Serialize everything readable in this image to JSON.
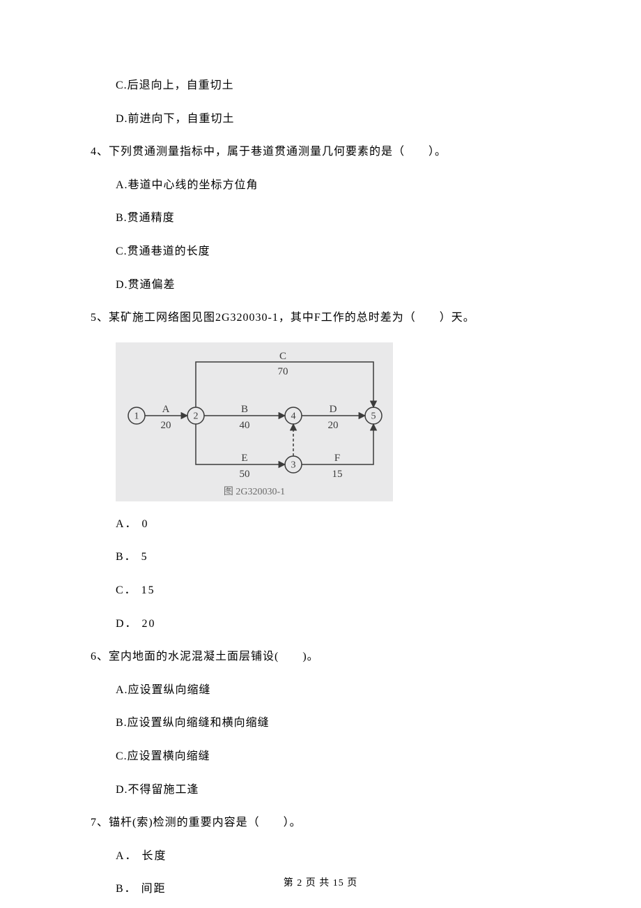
{
  "q3": {
    "optC": "C.后退向上，自重切土",
    "optD": "D.前进向下，自重切土"
  },
  "q4": {
    "stem": "4、下列贯通测量指标中，属于巷道贯通测量几何要素的是（　　）。",
    "optA": "A.巷道中心线的坐标方位角",
    "optB": "B.贯通精度",
    "optC": "C.贯通巷道的长度",
    "optD": "D.贯通偏差"
  },
  "q5": {
    "stem": "5、某矿施工网络图见图2G320030-1，其中F工作的总时差为（　　）天。",
    "optA": "A． 0",
    "optB": "B． 5",
    "optC": "C． 15",
    "optD": "D． 20"
  },
  "q6": {
    "stem": "6、室内地面的水泥混凝土面层铺设(　　)。",
    "optA": "A.应设置纵向缩缝",
    "optB": "B.应设置纵向缩缝和横向缩缝",
    "optC": "C.应设置横向缩缝",
    "optD": "D.不得留施工逢"
  },
  "q7": {
    "stem": "7、锚杆(索)检测的重要内容是（　　）。",
    "optA": "A． 长度",
    "optB": "B． 间距"
  },
  "diagram": {
    "caption": "图 2G320030-1",
    "labels": {
      "A": "A",
      "B": "B",
      "C": "C",
      "D": "D",
      "E": "E",
      "F": "F"
    },
    "values": {
      "A": "20",
      "B": "40",
      "C": "70",
      "D": "20",
      "E": "50",
      "F": "15"
    },
    "nodes": {
      "n1": "1",
      "n2": "2",
      "n3": "3",
      "n4": "4",
      "n5": "5"
    }
  },
  "chart_data": {
    "type": "network-diagram",
    "title": "图 2G320030-1",
    "nodes": [
      1,
      2,
      3,
      4,
      5
    ],
    "edges": [
      {
        "name": "A",
        "from": 1,
        "to": 2,
        "duration": 20
      },
      {
        "name": "B",
        "from": 2,
        "to": 4,
        "duration": 40
      },
      {
        "name": "C",
        "from": 2,
        "to": 5,
        "duration": 70
      },
      {
        "name": "D",
        "from": 4,
        "to": 5,
        "duration": 20
      },
      {
        "name": "E",
        "from": 2,
        "to": 3,
        "duration": 50
      },
      {
        "name": "F",
        "from": 3,
        "to": 5,
        "duration": 15
      },
      {
        "name": "dummy",
        "from": 3,
        "to": 4,
        "duration": 0,
        "dashed": true
      }
    ]
  },
  "footer": "第 2 页 共 15 页"
}
